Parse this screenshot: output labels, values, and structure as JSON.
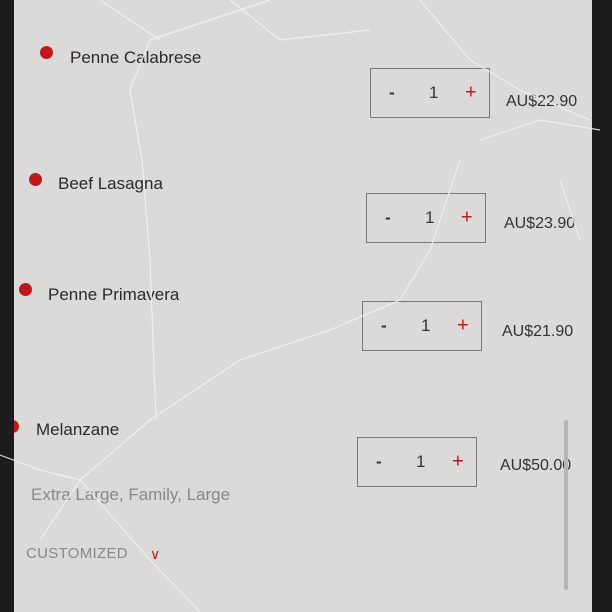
{
  "cart": {
    "items": [
      {
        "name": "Penne Calabrese",
        "qty": "1",
        "minus": "-",
        "plus": "+",
        "price": "AU$22.90"
      },
      {
        "name": "Beef Lasagna",
        "qty": "1",
        "minus": "-",
        "plus": "+",
        "price": "AU$23.90"
      },
      {
        "name": "Penne Primavera",
        "qty": "1",
        "minus": "-",
        "plus": "+",
        "price": "AU$21.90"
      },
      {
        "name": "Melanzane",
        "qty": "1",
        "minus": "-",
        "plus": "+",
        "price": "AU$50.00",
        "options": "Extra Large, Family, Large",
        "customized_label": "CUSTOMIZED"
      }
    ]
  },
  "colors": {
    "accent": "#c0181f",
    "background": "#dcdad8"
  },
  "icons": {
    "bullet": "bullet-dot-icon",
    "chevron": "chevron-down-icon"
  }
}
